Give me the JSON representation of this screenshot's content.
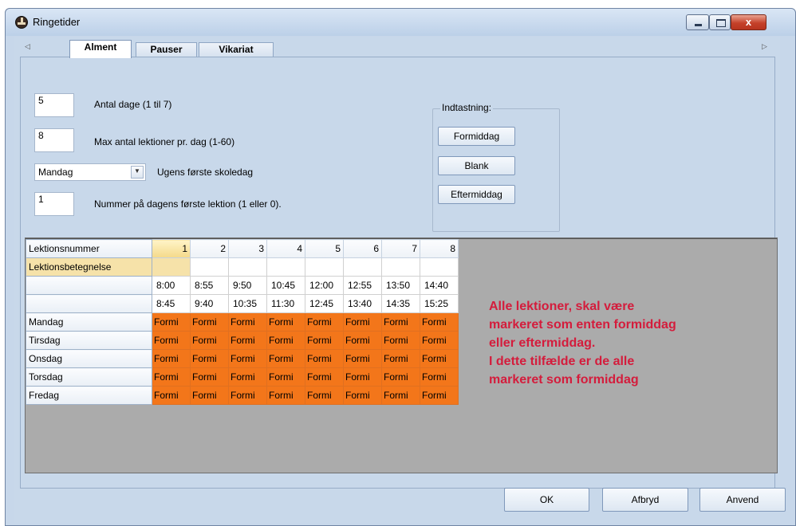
{
  "window": {
    "title": "Ringetider",
    "close_glyph": "x"
  },
  "tabs": [
    {
      "label": "Alment",
      "active": true
    },
    {
      "label": "Pauser",
      "active": false
    },
    {
      "label": "Vikariat",
      "active": false
    }
  ],
  "tab_scroll": {
    "left": "◁",
    "right": "▷"
  },
  "settings": {
    "days_value": "5",
    "days_label": "Antal dage (1 til 7)",
    "max_value": "8",
    "max_label": "Max antal lektioner pr. dag (1-60)",
    "firstday_value": "Mandag",
    "firstday_label": "Ugens første skoledag",
    "firstlesson_value": "1",
    "firstlesson_label": "Nummer på dagens første lektion (1 eller 0)."
  },
  "input_group": {
    "title": "Indtastning:",
    "buttons": [
      "Formiddag",
      "Blank",
      "Eftermiddag"
    ]
  },
  "grid": {
    "header_label": "Lektionsnummer",
    "columns": [
      "1",
      "2",
      "3",
      "4",
      "5",
      "6",
      "7",
      "8"
    ],
    "designation_label": "Lektionsbetegnelse",
    "start_times": [
      "8:00",
      "8:55",
      "9:50",
      "10:45",
      "12:00",
      "12:55",
      "13:50",
      "14:40"
    ],
    "end_times": [
      "8:45",
      "9:40",
      "10:35",
      "11:30",
      "12:45",
      "13:40",
      "14:35",
      "15:25"
    ],
    "days": [
      {
        "name": "Mandag",
        "cells": [
          "Formi",
          "Formi",
          "Formi",
          "Formi",
          "Formi",
          "Formi",
          "Formi",
          "Formi"
        ]
      },
      {
        "name": "Tirsdag",
        "cells": [
          "Formi",
          "Formi",
          "Formi",
          "Formi",
          "Formi",
          "Formi",
          "Formi",
          "Formi"
        ]
      },
      {
        "name": "Onsdag",
        "cells": [
          "Formi",
          "Formi",
          "Formi",
          "Formi",
          "Formi",
          "Formi",
          "Formi",
          "Formi"
        ]
      },
      {
        "name": "Torsdag",
        "cells": [
          "Formi",
          "Formi",
          "Formi",
          "Formi",
          "Formi",
          "Formi",
          "Formi",
          "Formi"
        ]
      },
      {
        "name": "Fredag",
        "cells": [
          "Formi",
          "Formi",
          "Formi",
          "Formi",
          "Formi",
          "Formi",
          "Formi",
          "Formi"
        ]
      }
    ]
  },
  "annotation": {
    "lines": [
      "Alle lektioner, skal være",
      "markeret som enten formiddag",
      "eller eftermiddag.",
      "I dette tilfælde er de alle",
      "markeret som formiddag"
    ],
    "color": "#d41c3c"
  },
  "buttons": {
    "ok": "OK",
    "cancel": "Afbryd",
    "apply": "Anvend"
  },
  "colors": {
    "formiddag": "#f3761a",
    "designation": "#f6e2a9"
  }
}
